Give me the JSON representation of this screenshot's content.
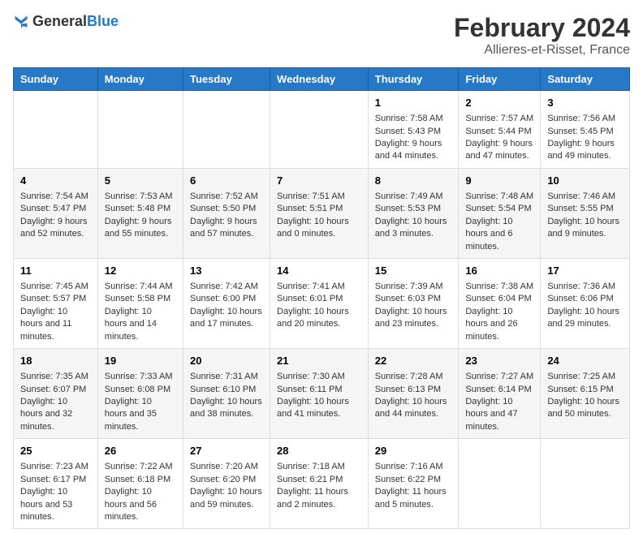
{
  "header": {
    "logo_general": "General",
    "logo_blue": "Blue",
    "title": "February 2024",
    "subtitle": "Allieres-et-Risset, France"
  },
  "columns": [
    "Sunday",
    "Monday",
    "Tuesday",
    "Wednesday",
    "Thursday",
    "Friday",
    "Saturday"
  ],
  "weeks": [
    {
      "days": [
        {
          "empty": true
        },
        {
          "empty": true
        },
        {
          "empty": true
        },
        {
          "empty": true
        },
        {
          "num": "1",
          "sunrise": "7:58 AM",
          "sunset": "5:43 PM",
          "daylight": "9 hours and 44 minutes."
        },
        {
          "num": "2",
          "sunrise": "7:57 AM",
          "sunset": "5:44 PM",
          "daylight": "9 hours and 47 minutes."
        },
        {
          "num": "3",
          "sunrise": "7:56 AM",
          "sunset": "5:45 PM",
          "daylight": "9 hours and 49 minutes."
        }
      ]
    },
    {
      "days": [
        {
          "num": "4",
          "sunrise": "7:54 AM",
          "sunset": "5:47 PM",
          "daylight": "9 hours and 52 minutes."
        },
        {
          "num": "5",
          "sunrise": "7:53 AM",
          "sunset": "5:48 PM",
          "daylight": "9 hours and 55 minutes."
        },
        {
          "num": "6",
          "sunrise": "7:52 AM",
          "sunset": "5:50 PM",
          "daylight": "9 hours and 57 minutes."
        },
        {
          "num": "7",
          "sunrise": "7:51 AM",
          "sunset": "5:51 PM",
          "daylight": "10 hours and 0 minutes."
        },
        {
          "num": "8",
          "sunrise": "7:49 AM",
          "sunset": "5:53 PM",
          "daylight": "10 hours and 3 minutes."
        },
        {
          "num": "9",
          "sunrise": "7:48 AM",
          "sunset": "5:54 PM",
          "daylight": "10 hours and 6 minutes."
        },
        {
          "num": "10",
          "sunrise": "7:46 AM",
          "sunset": "5:55 PM",
          "daylight": "10 hours and 9 minutes."
        }
      ]
    },
    {
      "days": [
        {
          "num": "11",
          "sunrise": "7:45 AM",
          "sunset": "5:57 PM",
          "daylight": "10 hours and 11 minutes."
        },
        {
          "num": "12",
          "sunrise": "7:44 AM",
          "sunset": "5:58 PM",
          "daylight": "10 hours and 14 minutes."
        },
        {
          "num": "13",
          "sunrise": "7:42 AM",
          "sunset": "6:00 PM",
          "daylight": "10 hours and 17 minutes."
        },
        {
          "num": "14",
          "sunrise": "7:41 AM",
          "sunset": "6:01 PM",
          "daylight": "10 hours and 20 minutes."
        },
        {
          "num": "15",
          "sunrise": "7:39 AM",
          "sunset": "6:03 PM",
          "daylight": "10 hours and 23 minutes."
        },
        {
          "num": "16",
          "sunrise": "7:38 AM",
          "sunset": "6:04 PM",
          "daylight": "10 hours and 26 minutes."
        },
        {
          "num": "17",
          "sunrise": "7:36 AM",
          "sunset": "6:06 PM",
          "daylight": "10 hours and 29 minutes."
        }
      ]
    },
    {
      "days": [
        {
          "num": "18",
          "sunrise": "7:35 AM",
          "sunset": "6:07 PM",
          "daylight": "10 hours and 32 minutes."
        },
        {
          "num": "19",
          "sunrise": "7:33 AM",
          "sunset": "6:08 PM",
          "daylight": "10 hours and 35 minutes."
        },
        {
          "num": "20",
          "sunrise": "7:31 AM",
          "sunset": "6:10 PM",
          "daylight": "10 hours and 38 minutes."
        },
        {
          "num": "21",
          "sunrise": "7:30 AM",
          "sunset": "6:11 PM",
          "daylight": "10 hours and 41 minutes."
        },
        {
          "num": "22",
          "sunrise": "7:28 AM",
          "sunset": "6:13 PM",
          "daylight": "10 hours and 44 minutes."
        },
        {
          "num": "23",
          "sunrise": "7:27 AM",
          "sunset": "6:14 PM",
          "daylight": "10 hours and 47 minutes."
        },
        {
          "num": "24",
          "sunrise": "7:25 AM",
          "sunset": "6:15 PM",
          "daylight": "10 hours and 50 minutes."
        }
      ]
    },
    {
      "days": [
        {
          "num": "25",
          "sunrise": "7:23 AM",
          "sunset": "6:17 PM",
          "daylight": "10 hours and 53 minutes."
        },
        {
          "num": "26",
          "sunrise": "7:22 AM",
          "sunset": "6:18 PM",
          "daylight": "10 hours and 56 minutes."
        },
        {
          "num": "27",
          "sunrise": "7:20 AM",
          "sunset": "6:20 PM",
          "daylight": "10 hours and 59 minutes."
        },
        {
          "num": "28",
          "sunrise": "7:18 AM",
          "sunset": "6:21 PM",
          "daylight": "11 hours and 2 minutes."
        },
        {
          "num": "29",
          "sunrise": "7:16 AM",
          "sunset": "6:22 PM",
          "daylight": "11 hours and 5 minutes."
        },
        {
          "empty": true
        },
        {
          "empty": true
        }
      ]
    }
  ]
}
